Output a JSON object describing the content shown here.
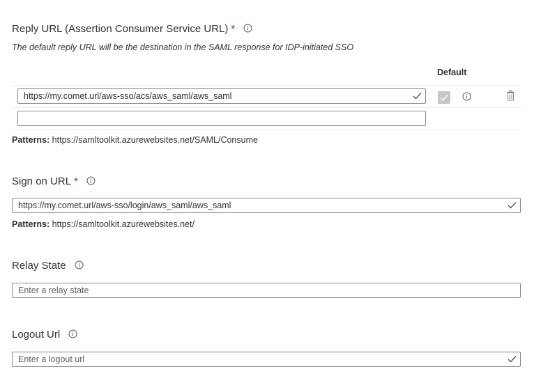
{
  "reply_url": {
    "label": "Reply URL (Assertion Consumer Service URL)",
    "required_mark": "*",
    "description": "The default reply URL will be the destination in the SAML response for IDP-initiated SSO",
    "column_default": "Default",
    "rows": [
      {
        "value": "https://my.comet.url/aws-sso/acs/aws_saml/aws_saml",
        "placeholder": ""
      },
      {
        "value": "",
        "placeholder": ""
      }
    ],
    "patterns_label": "Patterns:",
    "patterns_value": "https://samltoolkit.azurewebsites.net/SAML/Consume"
  },
  "sign_on_url": {
    "label": "Sign on URL",
    "required_mark": "*",
    "value": "https://my.comet.url/aws-sso/login/aws_saml/aws_saml",
    "patterns_label": "Patterns:",
    "patterns_value": "https://samltoolkit.azurewebsites.net/"
  },
  "relay_state": {
    "label": "Relay State",
    "placeholder": "Enter a relay state"
  },
  "logout_url": {
    "label": "Logout Url",
    "placeholder": "Enter a logout url"
  },
  "colors": {
    "required": "#a4262c",
    "check": "#107c10",
    "border": "#8a8886"
  }
}
